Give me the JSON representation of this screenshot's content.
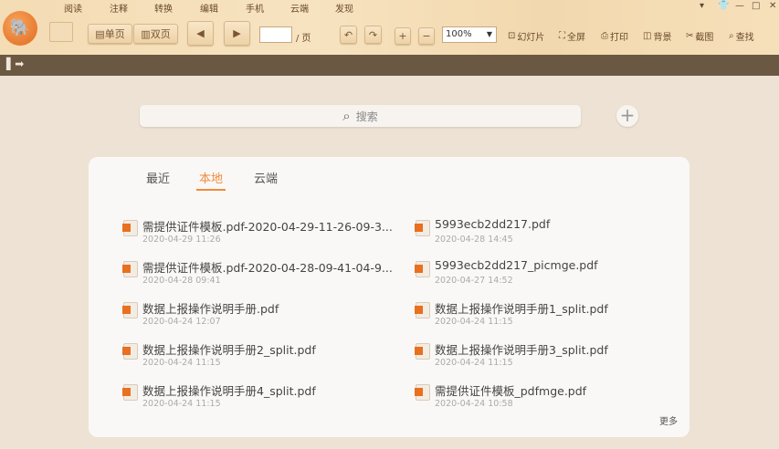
{
  "menu": [
    "阅读",
    "注释",
    "转换",
    "编辑",
    "手机",
    "云端",
    "发现"
  ],
  "toolbar": {
    "single_page": "单页",
    "double_page": "双页",
    "page_suffix": "/ 页",
    "zoom": "100%",
    "slideshow": "幻灯片",
    "fullscreen": "全屏",
    "print": "打印",
    "background": "背景",
    "screenshot": "截图",
    "find": "查找"
  },
  "search": {
    "placeholder": "搜索"
  },
  "tabs": [
    "最近",
    "本地",
    "云端"
  ],
  "files": [
    {
      "name": "需提供证件模板.pdf-2020-04-29-11-26-09-3...",
      "date": "2020-04-29 11:26"
    },
    {
      "name": "5993ecb2dd217.pdf",
      "date": "2020-04-28 14:45"
    },
    {
      "name": "需提供证件模板.pdf-2020-04-28-09-41-04-9...",
      "date": "2020-04-28 09:41"
    },
    {
      "name": "5993ecb2dd217_picmge.pdf",
      "date": "2020-04-27 14:52"
    },
    {
      "name": "数据上报操作说明手册.pdf",
      "date": "2020-04-24 12:07"
    },
    {
      "name": "数据上报操作说明手册1_split.pdf",
      "date": "2020-04-24 11:15"
    },
    {
      "name": "数据上报操作说明手册2_split.pdf",
      "date": "2020-04-24 11:15"
    },
    {
      "name": "数据上报操作说明手册3_split.pdf",
      "date": "2020-04-24 11:15"
    },
    {
      "name": "数据上报操作说明手册4_split.pdf",
      "date": "2020-04-24 11:15"
    },
    {
      "name": "需提供证件模板_pdfmge.pdf",
      "date": "2020-04-24 10:58"
    }
  ],
  "more": "更多",
  "colors": {
    "accent": "#f08a3c",
    "band": "#6b5843"
  }
}
